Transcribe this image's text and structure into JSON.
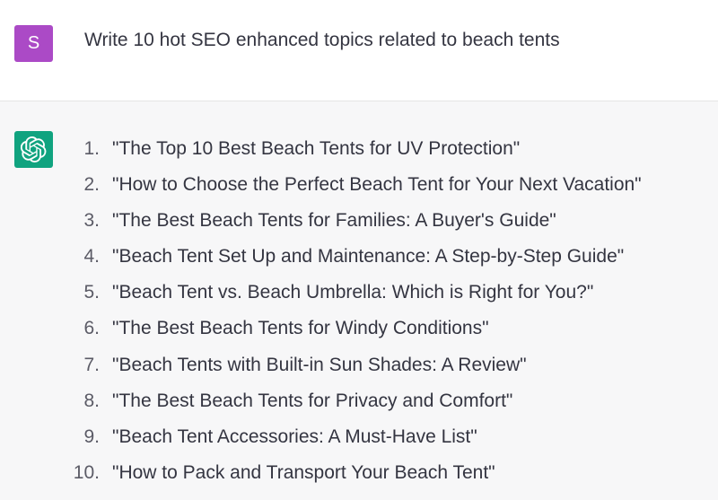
{
  "user": {
    "avatar_letter": "S",
    "avatar_color": "#ab4ac6",
    "message": "Write 10 hot SEO enhanced topics related to beach tents"
  },
  "assistant": {
    "avatar_icon": "openai-logo-icon",
    "avatar_color": "#10a37f",
    "topics": [
      {
        "num": "1.",
        "text": "\"The Top 10 Best Beach Tents for UV Protection\""
      },
      {
        "num": "2.",
        "text": "\"How to Choose the Perfect Beach Tent for Your Next Vacation\""
      },
      {
        "num": "3.",
        "text": "\"The Best Beach Tents for Families: A Buyer's Guide\""
      },
      {
        "num": "4.",
        "text": "\"Beach Tent Set Up and Maintenance: A Step-by-Step Guide\""
      },
      {
        "num": "5.",
        "text": "\"Beach Tent vs. Beach Umbrella: Which is Right for You?\""
      },
      {
        "num": "6.",
        "text": "\"The Best Beach Tents for Windy Conditions\""
      },
      {
        "num": "7.",
        "text": "\"Beach Tents with Built-in Sun Shades: A Review\""
      },
      {
        "num": "8.",
        "text": "\"The Best Beach Tents for Privacy and Comfort\""
      },
      {
        "num": "9.",
        "text": "\"Beach Tent Accessories: A Must-Have List\""
      },
      {
        "num": "10.",
        "text": "\"How to Pack and Transport Your Beach Tent\""
      }
    ]
  }
}
